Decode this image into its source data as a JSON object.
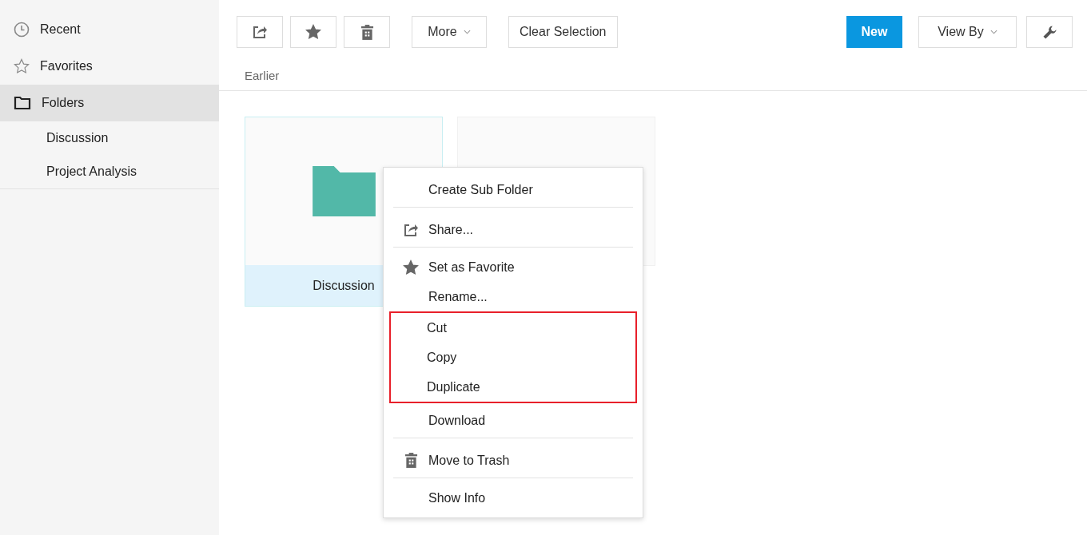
{
  "sidebar": {
    "items": [
      {
        "label": "Recent",
        "selected": false
      },
      {
        "label": "Favorites",
        "selected": false
      },
      {
        "label": "Folders",
        "selected": true,
        "children": [
          {
            "label": "Discussion",
            "selected": false
          },
          {
            "label": "Project Analysis",
            "selected": false
          }
        ]
      }
    ]
  },
  "toolbar": {
    "left": [
      {
        "kind": "share"
      },
      {
        "kind": "star"
      },
      {
        "kind": "trash"
      },
      {
        "kind": "dropdown",
        "label": "More"
      },
      {
        "kind": "text",
        "label": "Clear Selection"
      }
    ],
    "right": [
      {
        "kind": "primary",
        "label": "New"
      },
      {
        "kind": "dropdown",
        "label": "View By"
      },
      {
        "kind": "wrench"
      }
    ]
  },
  "section_title": "Earlier",
  "folders": [
    {
      "name": "Discussion",
      "selected": true
    },
    {
      "selected": false
    }
  ],
  "context_menu": {
    "groups": [
      {
        "highlighted": false,
        "divider_after": true,
        "items": [
          {
            "label": "Create Sub Folder",
            "kind": "plain"
          }
        ]
      },
      {
        "highlighted": false,
        "divider_after": true,
        "items": [
          {
            "label": "Share...",
            "kind": "share"
          }
        ]
      },
      {
        "highlighted": false,
        "divider_after": false,
        "items": [
          {
            "label": "Set as Favorite",
            "kind": "star"
          },
          {
            "label": "Rename...",
            "kind": "plain"
          }
        ]
      },
      {
        "highlighted": true,
        "divider_after": false,
        "items": [
          {
            "label": "Cut",
            "kind": "plain"
          },
          {
            "label": "Copy",
            "kind": "plain"
          },
          {
            "label": "Duplicate",
            "kind": "plain"
          }
        ]
      },
      {
        "highlighted": false,
        "divider_after": true,
        "items": [
          {
            "label": "Download",
            "kind": "plain"
          }
        ]
      },
      {
        "highlighted": false,
        "divider_after": true,
        "items": [
          {
            "label": "Move to Trash",
            "kind": "trash"
          }
        ]
      },
      {
        "highlighted": false,
        "divider_after": false,
        "items": [
          {
            "label": "Show Info",
            "kind": "plain"
          }
        ]
      }
    ]
  }
}
